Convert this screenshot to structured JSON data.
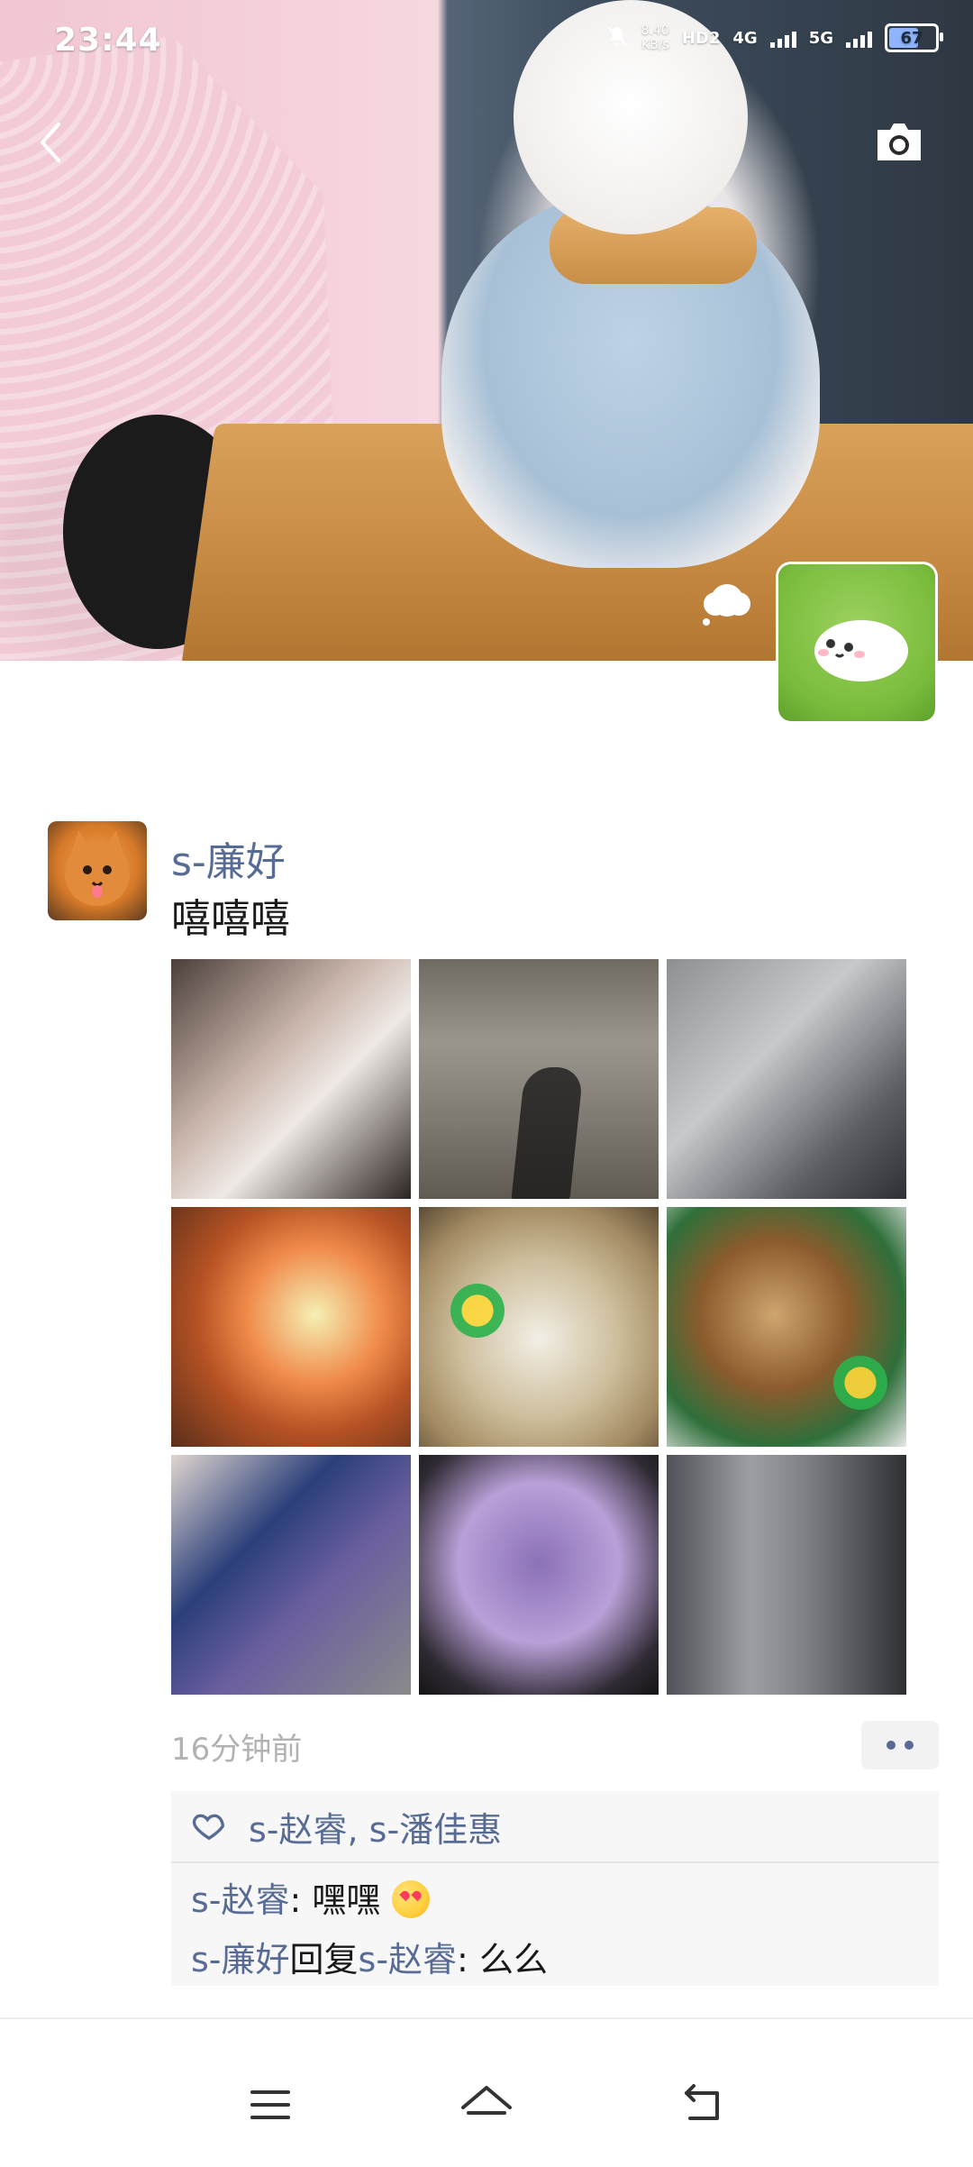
{
  "status_bar": {
    "time": "23:44",
    "speed_value": "8.40",
    "speed_unit": "KB/s",
    "hd_label": "HD2",
    "net1": "4G",
    "net2": "5G",
    "battery": "67"
  },
  "header": {
    "back_icon": "chevron-left-icon",
    "camera_icon": "camera-icon"
  },
  "post": {
    "author": "s-廉好",
    "text": "嘻嘻嘻",
    "time_ago": "16分钟前",
    "likes": "s-赵睿, s-潘佳惠",
    "comments": [
      {
        "name": "s-赵睿",
        "sep": ": ",
        "text": "嘿嘿"
      },
      {
        "name": "s-廉好",
        "reply_word": "回复",
        "reply_to": "s-赵睿",
        "sep": ": ",
        "text": "么么"
      }
    ]
  },
  "colors": {
    "link": "#576b95",
    "meta": "#b2b2b2",
    "panel": "#f7f7f7"
  }
}
